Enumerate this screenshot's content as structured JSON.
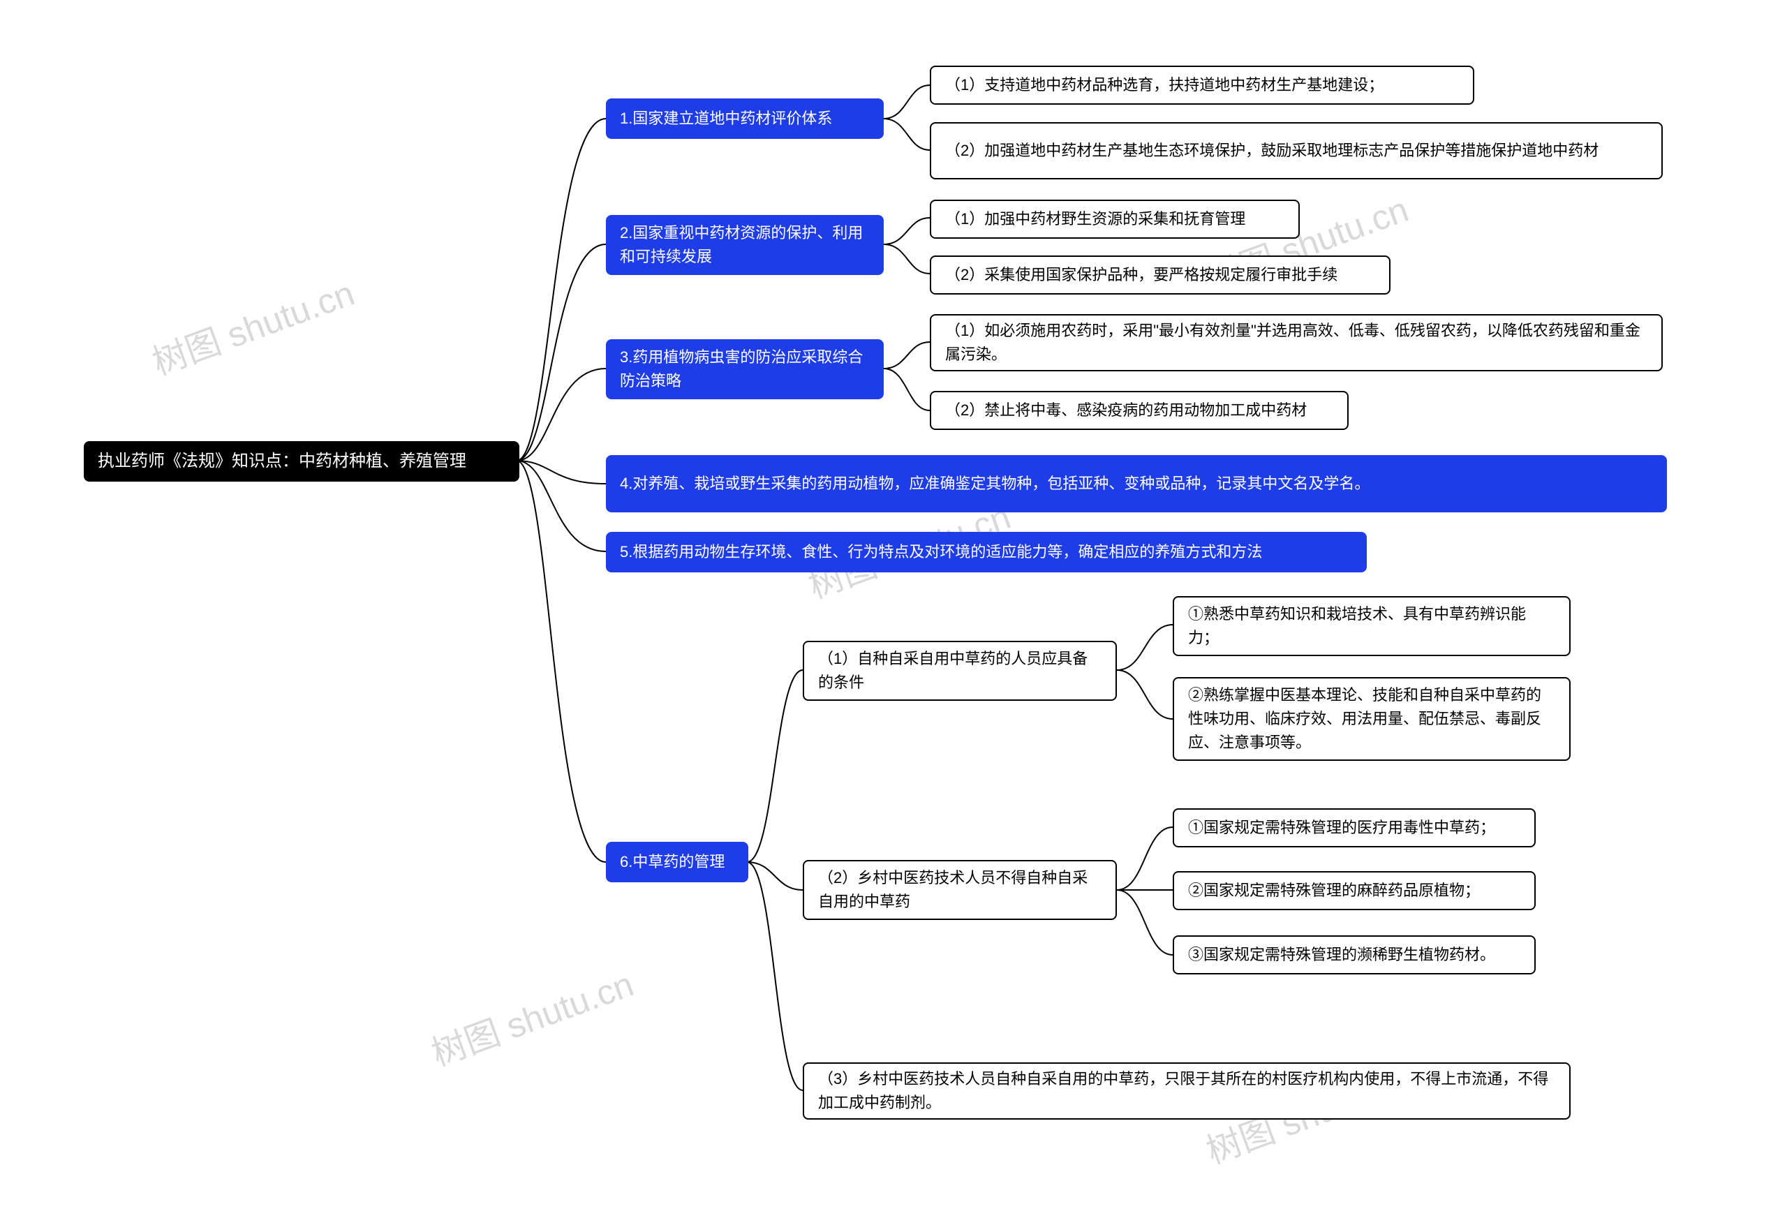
{
  "watermark": "树图 shutu.cn",
  "root": {
    "label": "执业药师《法规》知识点：中药材种植、养殖管理"
  },
  "b1": {
    "label": "1.国家建立道地中药材评价体系",
    "c1": "（1）支持道地中药材品种选育，扶持道地中药材生产基地建设；",
    "c2": "（2）加强道地中药材生产基地生态环境保护，鼓励采取地理标志产品保护等措施保护道地中药材"
  },
  "b2": {
    "label": "2.国家重视中药材资源的保护、利用和可持续发展",
    "c1": "（1）加强中药材野生资源的采集和抚育管理",
    "c2": "（2）采集使用国家保护品种，要严格按规定履行审批手续"
  },
  "b3": {
    "label": "3.药用植物病虫害的防治应采取综合防治策略",
    "c1": "（1）如必须施用农药时，采用\"最小有效剂量\"并选用高效、低毒、低残留农药，以降低农药残留和重金属污染。",
    "c2": "（2）禁止将中毒、感染疫病的药用动物加工成中药材"
  },
  "b4": {
    "label": "4.对养殖、栽培或野生采集的药用动植物，应准确鉴定其物种，包括亚种、变种或品种，记录其中文名及学名。"
  },
  "b5": {
    "label": "5.根据药用动物生存环境、食性、行为特点及对环境的适应能力等，确定相应的养殖方式和方法"
  },
  "b6": {
    "label": "6.中草药的管理",
    "c1": {
      "label": "（1）自种自采自用中草药的人员应具备的条件",
      "d1": "①熟悉中草药知识和栽培技术、具有中草药辨识能力；",
      "d2": "②熟练掌握中医基本理论、技能和自种自采中草药的性味功用、临床疗效、用法用量、配伍禁忌、毒副反应、注意事项等。"
    },
    "c2": {
      "label": "（2）乡村中医药技术人员不得自种自采自用的中草药",
      "d1": "①国家规定需特殊管理的医疗用毒性中草药；",
      "d2": "②国家规定需特殊管理的麻醉药品原植物；",
      "d3": "③国家规定需特殊管理的濒稀野生植物药材。"
    },
    "c3": "（3）乡村中医药技术人员自种自采自用的中草药，只限于其所在的村医疗机构内使用，不得上市流通，不得加工成中药制剂。"
  }
}
